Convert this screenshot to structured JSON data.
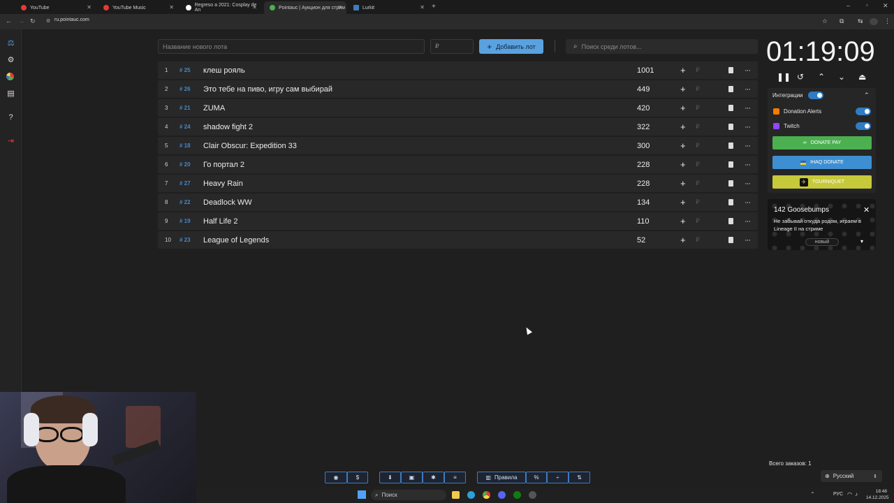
{
  "browser": {
    "tabs": [
      {
        "label": "YouTube",
        "color": "#e53935"
      },
      {
        "label": "YouTube Music",
        "color": "#e53935"
      },
      {
        "label": "Regreso a 2021: Cosplay de An",
        "color": "#ffffff"
      },
      {
        "label": "Pointauc | Аукцион для стрим",
        "color": "#4caf50"
      },
      {
        "label": "Lurkit",
        "color": "#3e7cc0"
      }
    ],
    "url": "ru.pointauc.com"
  },
  "controls": {
    "new_lot_placeholder": "Название нового лота",
    "amount_placeholder": "₽",
    "add_button": "Добавить лот",
    "search_placeholder": "Поиск среди лотов..."
  },
  "lots": [
    {
      "num": "1",
      "id": "# 25",
      "name": "клеш рояль",
      "amount": "1001"
    },
    {
      "num": "2",
      "id": "# 26",
      "name": "Это тебе на пиво, игру сам выбирай",
      "amount": "449"
    },
    {
      "num": "3",
      "id": "# 21",
      "name": "ZUMA",
      "amount": "420"
    },
    {
      "num": "4",
      "id": "# 24",
      "name": "shadow fight 2",
      "amount": "322"
    },
    {
      "num": "5",
      "id": "# 18",
      "name": "Clair Obscur: Expedition 33",
      "amount": "300"
    },
    {
      "num": "6",
      "id": "# 20",
      "name": "Го портал 2",
      "amount": "228"
    },
    {
      "num": "7",
      "id": "# 27",
      "name": "Heavy Rain",
      "amount": "228"
    },
    {
      "num": "8",
      "id": "# 22",
      "name": "Deadlock WW",
      "amount": "134"
    },
    {
      "num": "9",
      "id": "# 19",
      "name": "Half Life 2",
      "amount": "110"
    },
    {
      "num": "10",
      "id": "# 23",
      "name": "League of Legends",
      "amount": "52"
    }
  ],
  "lot_actions": {
    "plus": "+",
    "currency": "₽",
    "more": "···"
  },
  "timer": {
    "value": "01:19:09"
  },
  "integrations": {
    "title": "Интеграции",
    "items": [
      {
        "label": "Donation Alerts",
        "enabled": true
      },
      {
        "label": "Twitch",
        "enabled": true
      }
    ],
    "buttons": [
      {
        "label": "DONATE PAY",
        "color": "#4caf50"
      },
      {
        "label": "IHAQ DONATE",
        "color": "#3d8fd1"
      },
      {
        "label": "TOURNIQUET",
        "color": "#c6c93a"
      }
    ]
  },
  "notification": {
    "title": "142 Goosebumps",
    "message": "Не забывай откуда родом, играем в Lineage II на стриме",
    "badge": "новый"
  },
  "bottom_toolbar": {
    "rules_label": "Правила",
    "percent_label": "%"
  },
  "footer": {
    "orders_total": "Всего заказов: 1",
    "language": "Русский"
  },
  "taskbar": {
    "search_placeholder": "Поиск",
    "lang": "РУС",
    "time": "18:48",
    "date": "14.12.2025"
  },
  "colors": {
    "accent": "#5aa1e0",
    "lot_id": "#4a86c5",
    "background": "#1f1f1f"
  }
}
